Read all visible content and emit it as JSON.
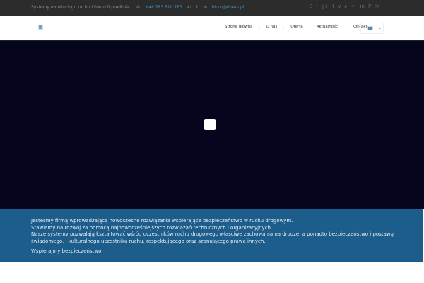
{
  "topbar": {
    "tagline": "Systemy monitoringu ruchu i kontroli prędkości",
    "phone": "+48 783 810 783",
    "phone2": "1",
    "email": "biuro@duers.pl",
    "social": [
      {
        "name": "skype-icon",
        "glyph": "S"
      },
      {
        "name": "facebook-icon",
        "glyph": "f"
      },
      {
        "name": "google-plus-icon",
        "glyph": "g+"
      },
      {
        "name": "twitter-icon",
        "glyph": "t"
      },
      {
        "name": "vimeo-icon",
        "glyph": "V"
      },
      {
        "name": "youtube-icon",
        "glyph": "▸"
      },
      {
        "name": "flickr-icon",
        "glyph": "••"
      },
      {
        "name": "linkedin-icon",
        "glyph": "in"
      },
      {
        "name": "pinterest-icon",
        "glyph": "P"
      },
      {
        "name": "dribbble-icon",
        "glyph": "◎"
      }
    ]
  },
  "nav": {
    "items": [
      "Strona główna",
      "O nas",
      "Oferta",
      "Aktualności",
      "Kontakt"
    ]
  },
  "intro": {
    "lines": [
      "Jesteśmy firmą wprowadzającą nowoczesne rozwiązania wspierające bezpieczeństwo w ruchu drogowym.",
      "Stawiamy na rozwój za pomocą najnowocześniejszych rozwiązań technicznych i organizacyjnych.",
      "Nasze systemy pozwalają kształtować wśród uczestników ruchu drogowego właściwe zachowania na drodze, a ponadto bezpieczeństwo i postawę świadomego, i kulturalnego uczestnika ruchu, respektującego oraz szanującego prawa innych."
    ],
    "closing": "Wspierajmy bezpieczeństwo."
  }
}
